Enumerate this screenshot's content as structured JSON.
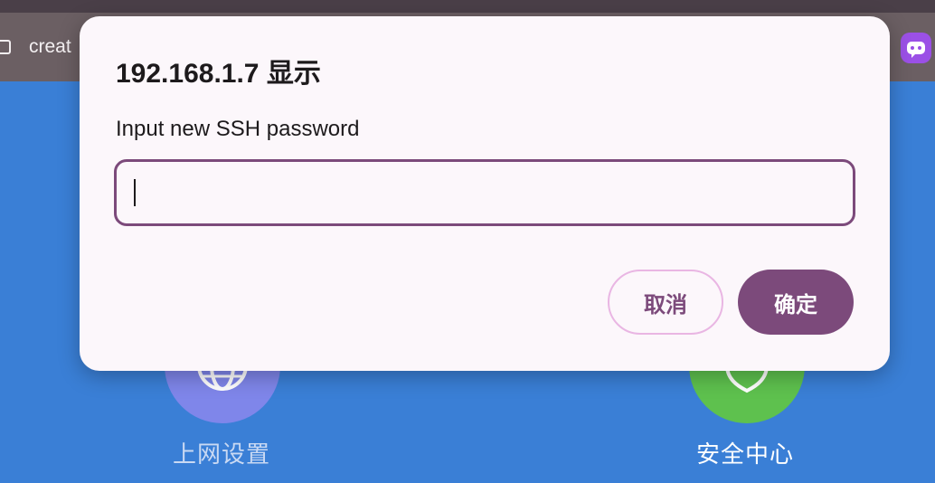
{
  "browser": {
    "tab_title": "creat",
    "extension_icon": "chat-bot-icon"
  },
  "app": {
    "features": [
      {
        "label": "上网设置",
        "icon": "globe-icon",
        "color": "#7f86ea"
      },
      {
        "label": "安全中心",
        "icon": "shield-icon",
        "color": "#5ec14e"
      }
    ],
    "background_color": "#3a7fd6"
  },
  "dialog": {
    "title": "192.168.1.7 显示",
    "message": "Input new SSH password",
    "input_value": "",
    "cancel_label": "取消",
    "ok_label": "确定",
    "accent_color": "#7c4a7b"
  }
}
